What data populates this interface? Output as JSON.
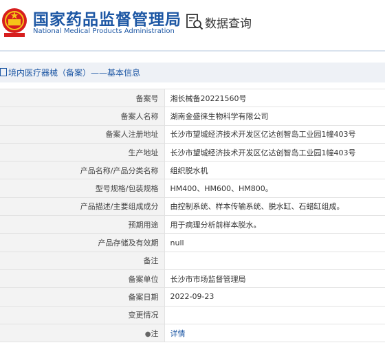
{
  "header": {
    "site_name_cn": "国家药品监督管理局",
    "site_name_en": "National Medical Products Administration",
    "section_title": "数据查询",
    "accent_color": "#1d57a4"
  },
  "breadcrumb": {
    "text": "境内医疗器械（备案）——基本信息"
  },
  "rows": [
    {
      "label": "备案号",
      "value": "湘长械备20221560号"
    },
    {
      "label": "备案人名称",
      "value": "湖南金盛徕生物科学有限公司"
    },
    {
      "label": "备案人注册地址",
      "value": "长沙市望城经济技术开发区亿达创智岛工业园1幢403号"
    },
    {
      "label": "生产地址",
      "value": "长沙市望城经济技术开发区亿达创智岛工业园1幢403号"
    },
    {
      "label": "产品名称/产品分类名称",
      "value": "组织脱水机"
    },
    {
      "label": "型号规格/包装规格",
      "value": "HM400、HM600、HM800。"
    },
    {
      "label": "产品描述/主要组成成分",
      "value": "由控制系统、样本传输系统、脱水缸、石蜡缸组成。"
    },
    {
      "label": "预期用途",
      "value": "用于病理分析前样本脱水。"
    },
    {
      "label": "产品存储及有效期",
      "value": "null"
    },
    {
      "label": "备注",
      "value": ""
    },
    {
      "label": "备案单位",
      "value": "长沙市市场监督管理局"
    },
    {
      "label": "备案日期",
      "value": "2022-09-23"
    },
    {
      "label": "变更情况",
      "value": ""
    }
  ],
  "note_row": {
    "icon": "location-pin-icon",
    "label": "注",
    "link_text": "详情"
  }
}
